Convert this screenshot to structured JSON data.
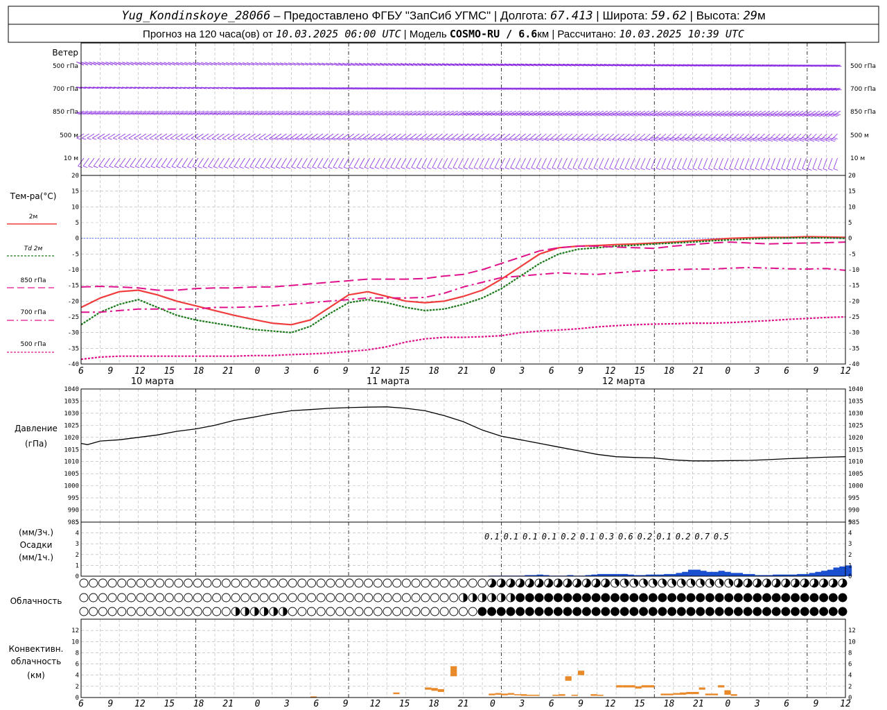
{
  "header": {
    "station": "Yug_Kondinskoye_28066",
    "provider": " – Предоставлено ФГБУ \"ЗапСиб УГМС\" | Долгота: ",
    "lon": "67.413",
    "lat_label": " | Широта: ",
    "lat": "59.62",
    "alt_label": " | Высота: ",
    "alt": "29",
    "alt_unit": "м",
    "line2_a": "Прогноз на 120 часа(ов) от ",
    "run_time": "10.03.2025 06:00 UTC",
    "line2_b": " | Модель ",
    "model": "COSMO-RU / 6.6",
    "model_unit": "км",
    "line2_c": " | Рассчитано: ",
    "calc_time": "10.03.2025 10:39 UTC"
  },
  "labels": {
    "wind": "Ветер",
    "wind_levels": [
      "500 гПа",
      "700 гПа",
      "850 гПа",
      "500 м",
      "10 м"
    ],
    "temp": "Тем-ра(°C)",
    "temp_legend": [
      {
        "text": "2м",
        "color": "#f03c3c",
        "dash": ""
      },
      {
        "text": "Td 2м",
        "color": "#1a7a1a",
        "dash": "3,2"
      },
      {
        "text": "850 гПа",
        "color": "#e0108a",
        "dash": "10,5"
      },
      {
        "text": "700 гПа",
        "color": "#e0108a",
        "dash": "10,4,2,4"
      },
      {
        "text": "500 гПа",
        "color": "#e0108a",
        "dash": "3,2"
      }
    ],
    "pressure": "Давление",
    "pressure_unit": "(гПа)",
    "precip_unit1": "(мм/3ч.)",
    "precip": "Осадки",
    "precip_unit2": "(мм/1ч.)",
    "cloud": "Облачность",
    "conv1": "Конвективн.",
    "conv2": "облачность",
    "conv3": "(км)",
    "dates": [
      "10 марта",
      "11 марта",
      "12 марта"
    ]
  },
  "x_ticks": [
    "6",
    "9",
    "12",
    "15",
    "18",
    "21",
    "0",
    "3",
    "6",
    "9",
    "12",
    "15",
    "18",
    "21",
    "0",
    "3",
    "6",
    "9",
    "12",
    "15",
    "18",
    "21",
    "0",
    "3",
    "6",
    "9",
    "12"
  ],
  "chart_data": [
    {
      "type": "line",
      "title": "Тем-ра(°C)",
      "x_hours": [
        0,
        3,
        6,
        9,
        12,
        15,
        18,
        21,
        24,
        27,
        30,
        33,
        36,
        39,
        42,
        45,
        48,
        51,
        54,
        57,
        60,
        63,
        66,
        69,
        72,
        75,
        78,
        81,
        84,
        87,
        90,
        93,
        96,
        99,
        102,
        105,
        108,
        111,
        114,
        117,
        120
      ],
      "ylim": [
        -40,
        20
      ],
      "y_ticks": [
        20,
        15,
        10,
        5,
        0,
        -5,
        -10,
        -15,
        -20,
        -25,
        -30,
        -35,
        -40
      ],
      "series": [
        {
          "name": "2м",
          "color": "#f03c3c",
          "values": [
            -22,
            -19,
            -17,
            -16.5,
            -18,
            -20,
            -21.5,
            -23,
            -24.5,
            -25.8,
            -27,
            -27.5,
            -26,
            -22,
            -18,
            -17,
            -18.5,
            -20,
            -20.5,
            -20,
            -18.5,
            -16.5,
            -13,
            -9,
            -5,
            -3,
            -2.5,
            -2.3,
            -2,
            -1.8,
            -1.5,
            -1.2,
            -0.8,
            -0.4,
            0,
            0.2,
            0.3,
            0.3,
            0.5,
            0.4,
            0.3
          ]
        },
        {
          "name": "Td 2м",
          "color": "#1a7a1a",
          "values": [
            -27.5,
            -23.5,
            -21,
            -19.5,
            -22,
            -24.5,
            -26,
            -27,
            -28,
            -29,
            -29.5,
            -30,
            -28,
            -24,
            -20.5,
            -19.5,
            -20.5,
            -22,
            -23,
            -22.5,
            -21,
            -19,
            -16,
            -12,
            -8,
            -5,
            -3.5,
            -3,
            -2.5,
            -2.2,
            -1.8,
            -1.5,
            -1.2,
            -0.8,
            -0.5,
            -0.2,
            0,
            0.1,
            0.2,
            0.1,
            0
          ]
        },
        {
          "name": "850 гПа",
          "color": "#e0108a",
          "values": [
            -15.5,
            -15.3,
            -15.5,
            -15.8,
            -16.5,
            -16.5,
            -16,
            -15.8,
            -15.8,
            -15.5,
            -15.5,
            -15,
            -14.5,
            -14,
            -13.5,
            -13,
            -13,
            -13,
            -12.8,
            -12,
            -11.5,
            -10,
            -8,
            -6,
            -4,
            -3,
            -2.5,
            -2.5,
            -2.8,
            -3,
            -3.2,
            -2.5,
            -2,
            -1.5,
            -1.2,
            -1.5,
            -1.8,
            -1.6,
            -1.5,
            -1.4,
            -1.2
          ]
        },
        {
          "name": "700 гПа",
          "color": "#e0108a",
          "values": [
            -23.5,
            -23.5,
            -23,
            -22.5,
            -22.5,
            -22.5,
            -22.5,
            -22,
            -22,
            -21.8,
            -21.5,
            -21,
            -20.5,
            -20,
            -19.5,
            -19,
            -19,
            -19,
            -18.8,
            -17.5,
            -15.5,
            -14,
            -12.5,
            -12,
            -11.5,
            -11,
            -11.3,
            -11.5,
            -11,
            -10.5,
            -10.2,
            -10,
            -9.8,
            -9.8,
            -9.5,
            -9.3,
            -9.5,
            -9.7,
            -9.8,
            -9.6,
            -10.2
          ]
        },
        {
          "name": "500 гПа",
          "color": "#e0108a",
          "values": [
            -38.5,
            -37.8,
            -37.5,
            -37.5,
            -37.5,
            -37.5,
            -37.5,
            -37.5,
            -37.5,
            -37.3,
            -37.3,
            -37,
            -36.8,
            -36.5,
            -36,
            -35.5,
            -34.5,
            -33,
            -32,
            -31.5,
            -31.5,
            -31.3,
            -31,
            -30,
            -29.5,
            -29.2,
            -28.8,
            -28.2,
            -27.8,
            -27.5,
            -27.3,
            -27.2,
            -27,
            -27,
            -26.8,
            -26.5,
            -26.2,
            -25.8,
            -25.5,
            -25.2,
            -25
          ]
        }
      ]
    },
    {
      "type": "line",
      "title": "Давление",
      "ylabel": "(гПа)",
      "ylim": [
        985,
        1040
      ],
      "y_ticks": [
        1040,
        1035,
        1030,
        1025,
        1020,
        1015,
        1010,
        1005,
        1000,
        995,
        990,
        985
      ],
      "x_hours": [
        0,
        1,
        3,
        6,
        9,
        12,
        15,
        18,
        21,
        24,
        27,
        30,
        33,
        36,
        39,
        42,
        45,
        48,
        51,
        54,
        57,
        60,
        63,
        66,
        69,
        72,
        75,
        78,
        81,
        84,
        87,
        90,
        93,
        96,
        99,
        102,
        105,
        108,
        111,
        114,
        117,
        120
      ],
      "values": [
        1017.5,
        1017,
        1018.5,
        1019,
        1020,
        1021,
        1022.5,
        1023.5,
        1025,
        1027,
        1028.3,
        1029.8,
        1031,
        1031.5,
        1032,
        1032.3,
        1032.5,
        1032.6,
        1032,
        1031,
        1029,
        1026.5,
        1023,
        1020.5,
        1019,
        1017.5,
        1016,
        1014.5,
        1013,
        1012,
        1011.7,
        1011.5,
        1010.7,
        1010.3,
        1010.3,
        1010.4,
        1010.5,
        1010.8,
        1011.2,
        1011.5,
        1011.8,
        1012
      ]
    },
    {
      "type": "bar",
      "title": "Осадки",
      "ylabel": "(мм/3ч.) / (мм/1ч.)",
      "ylim": [
        0,
        5
      ],
      "y_ticks": [
        5,
        4,
        3,
        2,
        1,
        0
      ],
      "color": "#1a4fd0",
      "hourly_start": 63,
      "hourly_values": [
        0,
        0.05,
        0.05,
        0.05,
        0.05,
        0.05,
        0.05,
        0.1,
        0.1,
        0.15,
        0.1,
        0.05,
        0.05,
        0.05,
        0.1,
        0.05,
        0.05,
        0.1,
        0.15,
        0.2,
        0.2,
        0.2,
        0.2,
        0.2,
        0.15,
        0.1,
        0.1,
        0.15,
        0.15,
        0.15,
        0.2,
        0.2,
        0.3,
        0.4,
        0.6,
        0.6,
        0.5,
        0.4,
        0.4,
        0.5,
        0.4,
        0.3,
        0.3,
        0.2,
        0.2,
        0.1,
        0.1,
        0.1,
        0.15,
        0.15,
        0.15,
        0.15,
        0.2,
        0.2,
        0.3,
        0.4,
        0.5,
        0.6,
        0.8,
        0.9,
        1.0
      ],
      "sums_3h": [
        {
          "x": 66,
          "label": "0.1"
        },
        {
          "x": 69,
          "label": "0.1"
        },
        {
          "x": 72,
          "label": "0.1"
        },
        {
          "x": 75,
          "label": "0.1"
        },
        {
          "x": 78,
          "label": "0.2"
        },
        {
          "x": 81,
          "label": "0.1"
        },
        {
          "x": 84,
          "label": "0.3"
        },
        {
          "x": 87,
          "label": "0.6"
        },
        {
          "x": 90,
          "label": "0.2"
        },
        {
          "x": 93,
          "label": "0.1"
        },
        {
          "x": 96,
          "label": "0.2"
        },
        {
          "x": 99,
          "label": "0.7"
        },
        {
          "x": 102,
          "label": "0.5"
        }
      ]
    },
    {
      "type": "bar",
      "title": "Конвективн. облачность",
      "ylabel": "(км)",
      "ylim": [
        0,
        14
      ],
      "y_ticks": [
        12,
        10,
        8,
        6,
        4,
        2,
        0
      ],
      "color": "#e88a2a",
      "bars": [
        {
          "x": 36,
          "base": 0,
          "top": 0.2
        },
        {
          "x": 49,
          "base": 0.6,
          "top": 0.9
        },
        {
          "x": 54,
          "base": 1.4,
          "top": 1.8
        },
        {
          "x": 55,
          "base": 1.2,
          "top": 1.7
        },
        {
          "x": 56,
          "base": 1.0,
          "top": 1.5
        },
        {
          "x": 58,
          "base": 3.8,
          "top": 5.6
        },
        {
          "x": 64,
          "base": 0.4,
          "top": 0.7
        },
        {
          "x": 65,
          "base": 0.5,
          "top": 0.8
        },
        {
          "x": 66,
          "base": 0.4,
          "top": 0.7
        },
        {
          "x": 67,
          "base": 0.5,
          "top": 0.8
        },
        {
          "x": 68,
          "base": 0.4,
          "top": 0.6
        },
        {
          "x": 69,
          "base": 0.3,
          "top": 0.6
        },
        {
          "x": 70,
          "base": 0.3,
          "top": 0.5
        },
        {
          "x": 71,
          "base": 0.3,
          "top": 0.5
        },
        {
          "x": 74,
          "base": 0.3,
          "top": 0.5
        },
        {
          "x": 75,
          "base": 0.3,
          "top": 0.6
        },
        {
          "x": 76,
          "base": 3.0,
          "top": 3.8
        },
        {
          "x": 77,
          "base": 0.3,
          "top": 0.5
        },
        {
          "x": 78,
          "base": 4.0,
          "top": 4.8
        },
        {
          "x": 80,
          "base": 0.3,
          "top": 0.6
        },
        {
          "x": 81,
          "base": 0.3,
          "top": 0.5
        },
        {
          "x": 84,
          "base": 1.8,
          "top": 2.2
        },
        {
          "x": 85,
          "base": 1.8,
          "top": 2.2
        },
        {
          "x": 86,
          "base": 1.8,
          "top": 2.2
        },
        {
          "x": 87,
          "base": 1.6,
          "top": 2.0
        },
        {
          "x": 88,
          "base": 1.8,
          "top": 2.2
        },
        {
          "x": 89,
          "base": 1.8,
          "top": 2.2
        },
        {
          "x": 91,
          "base": 0.4,
          "top": 0.7
        },
        {
          "x": 92,
          "base": 0.4,
          "top": 0.7
        },
        {
          "x": 93,
          "base": 0.5,
          "top": 0.8
        },
        {
          "x": 94,
          "base": 0.5,
          "top": 0.9
        },
        {
          "x": 95,
          "base": 0.6,
          "top": 1.0
        },
        {
          "x": 96,
          "base": 0.6,
          "top": 1.0
        },
        {
          "x": 97,
          "base": 1.4,
          "top": 1.8
        },
        {
          "x": 98,
          "base": 0.4,
          "top": 0.7
        },
        {
          "x": 99,
          "base": 0.4,
          "top": 0.7
        },
        {
          "x": 100,
          "base": 1.8,
          "top": 2.2
        },
        {
          "x": 101,
          "base": 0.5,
          "top": 1.3
        },
        {
          "x": 102,
          "base": 0.3,
          "top": 0.6
        }
      ]
    }
  ],
  "wind": {
    "color": "#8a2be2",
    "levels": [
      {
        "name": "500 гПа",
        "dir_start": 285,
        "dir_end": 270,
        "speed_start": 25,
        "speed_end": 55
      },
      {
        "name": "700 гПа",
        "dir_start": 275,
        "dir_end": 265,
        "speed_start": 20,
        "speed_end": 45
      },
      {
        "name": "850 гПа",
        "dir_start": 260,
        "dir_end": 250,
        "speed_start": 15,
        "speed_end": 35
      },
      {
        "name": "500 м",
        "dir_start": 250,
        "dir_end": 240,
        "speed_start": 10,
        "speed_end": 30
      },
      {
        "name": "10 м",
        "dir_start": 230,
        "dir_end": 210,
        "speed_start": 5,
        "speed_end": 15
      }
    ]
  },
  "clouds": {
    "low_overcast_from_hour": 63,
    "mid_overcast_from_hour": 66,
    "high_overcast_from_hour": 66
  }
}
